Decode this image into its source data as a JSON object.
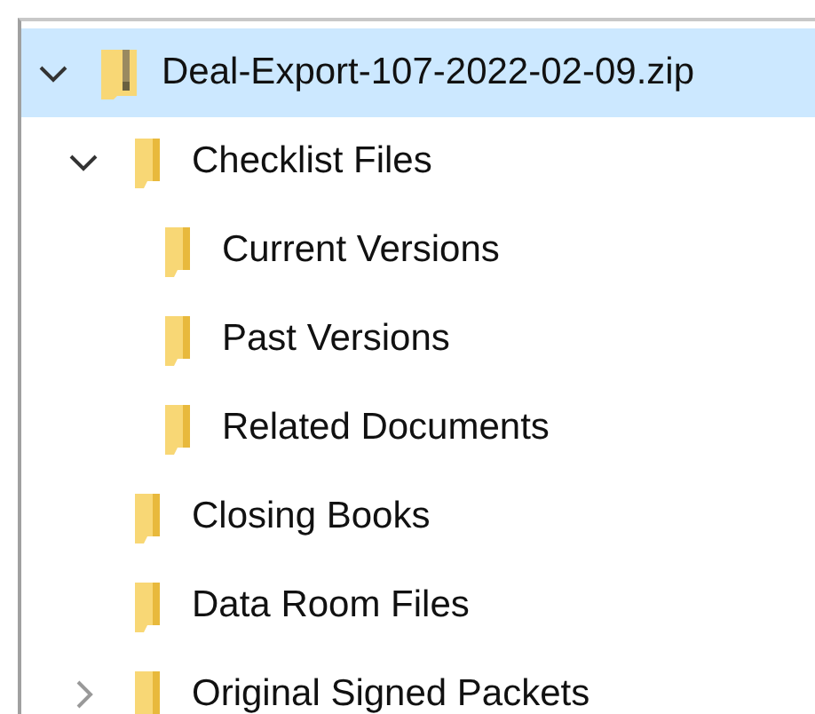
{
  "tree": [
    {
      "label": "Deal-Export-107-2022-02-09.zip",
      "kind": "zip",
      "selected": true,
      "expanded": true,
      "children": [
        {
          "label": "Checklist Files",
          "kind": "folder",
          "selected": false,
          "expanded": true,
          "children": [
            {
              "label": "Current Versions",
              "kind": "folder",
              "selected": false
            },
            {
              "label": "Past Versions",
              "kind": "folder",
              "selected": false
            },
            {
              "label": "Related Documents",
              "kind": "folder",
              "selected": false
            }
          ]
        },
        {
          "label": "Closing Books",
          "kind": "folder",
          "selected": false
        },
        {
          "label": "Data Room Files",
          "kind": "folder",
          "selected": false
        },
        {
          "label": "Original Signed Packets",
          "kind": "folder",
          "selected": false,
          "expanded": false
        }
      ]
    }
  ]
}
